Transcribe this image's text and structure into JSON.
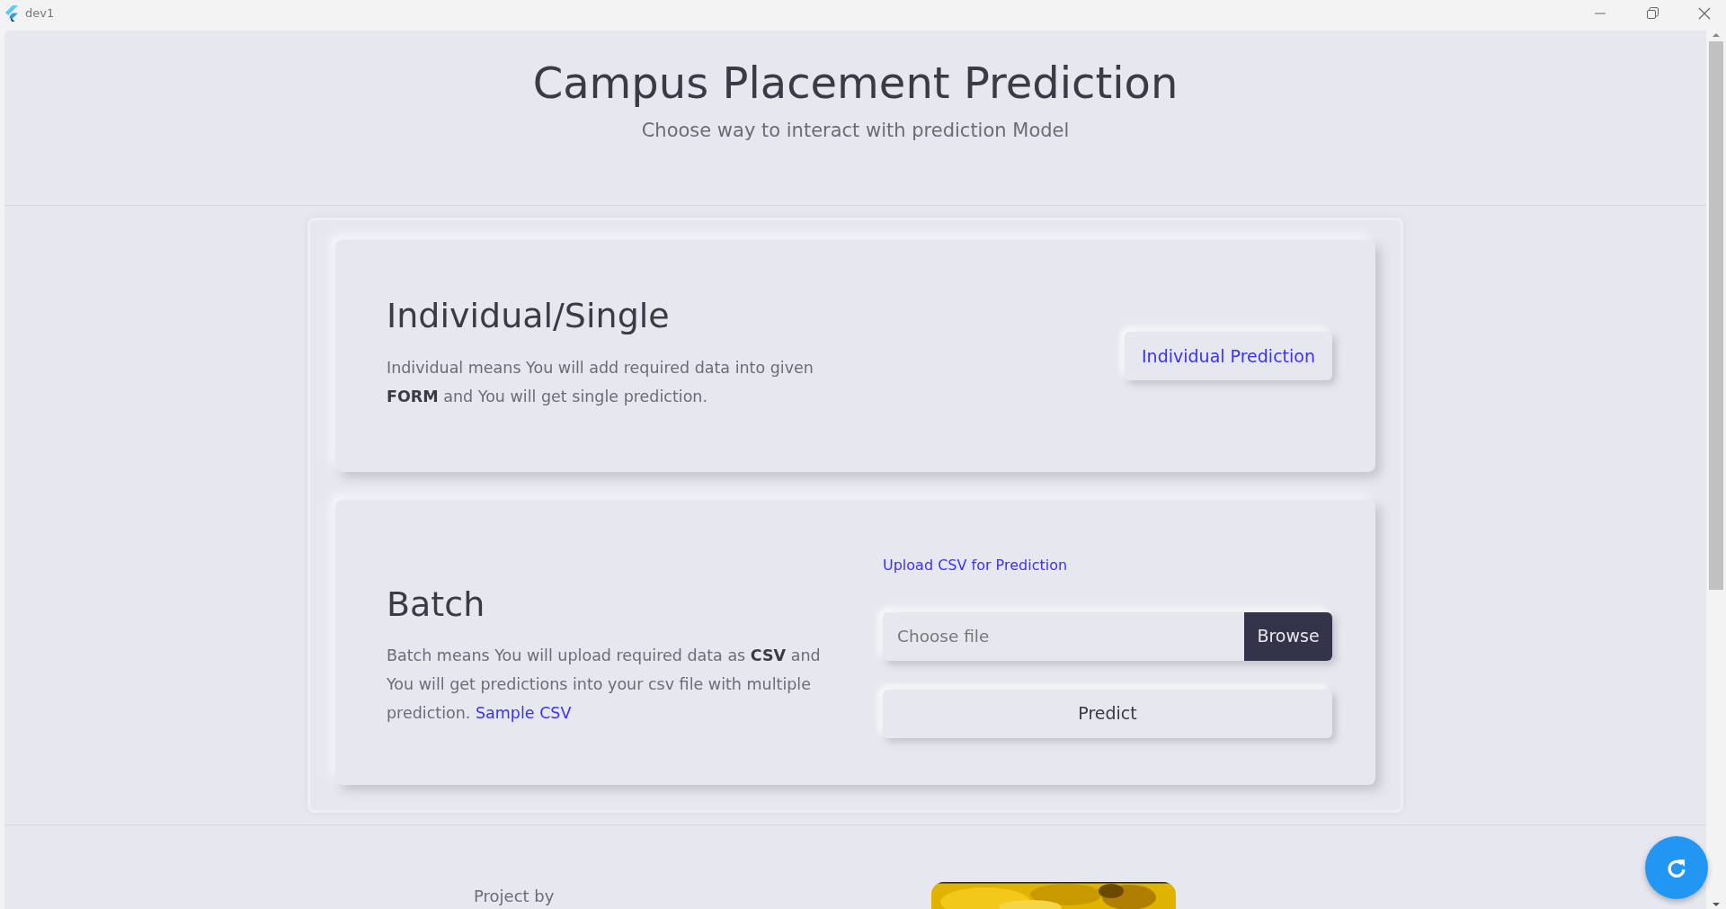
{
  "window": {
    "title": "dev1"
  },
  "header": {
    "title": "Campus Placement Prediction",
    "subtitle": "Choose way to interact with prediction Model"
  },
  "sections": [
    {
      "kind": "individual",
      "heading": "Individual/Single",
      "description": "Individual means You will add required data into given **FORM** and You will get single prediction.",
      "button": "Individual Prediction"
    },
    {
      "kind": "batch",
      "heading": "Batch",
      "description": "Batch means You will upload required data as **CSV** and You will get predictions into your csv file with multiple prediction.",
      "link": "Sample CSV",
      "upload_label": "Upload CSV for Prediction",
      "file_placeholder": "Choose file",
      "browse_button": "Browse",
      "predict_button": "Predict"
    }
  ],
  "footer": {
    "project_by": "Project by"
  }
}
